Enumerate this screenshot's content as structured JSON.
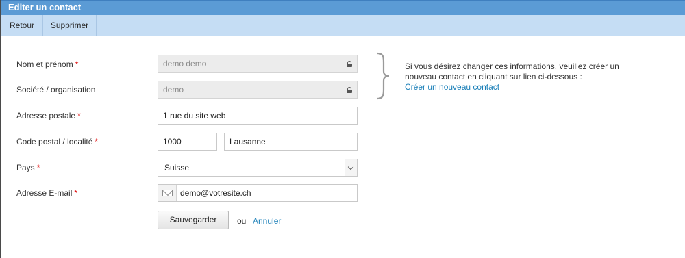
{
  "window": {
    "title": "Editer un contact"
  },
  "toolbar": {
    "back_label": "Retour",
    "delete_label": "Supprimer"
  },
  "form": {
    "required_marker": "*",
    "name": {
      "label": "Nom et prénom",
      "value": "demo demo",
      "locked": true
    },
    "company": {
      "label": "Société / organisation",
      "value": "demo",
      "locked": true
    },
    "address": {
      "label": "Adresse postale",
      "value": "1 rue du site web"
    },
    "postal": {
      "label": "Code postal / localité",
      "zip_value": "1000",
      "city_value": "Lausanne"
    },
    "country": {
      "label": "Pays",
      "selected": "Suisse"
    },
    "email": {
      "label": "Adresse E-mail",
      "value": "demo@votresite.ch"
    },
    "save_label": "Sauvegarder",
    "or_text": "ou",
    "cancel_label": "Annuler"
  },
  "info": {
    "text": "Si vous désirez changer ces informations, veuillez créer un nouveau contact en cliquant sur lien ci-dessous :",
    "link_label": "Créer un nouveau contact"
  },
  "colors": {
    "title_bar": "#5b9bd5",
    "toolbar": "#c5ddf4",
    "link": "#1a7fb8",
    "required": "#dd0000"
  }
}
